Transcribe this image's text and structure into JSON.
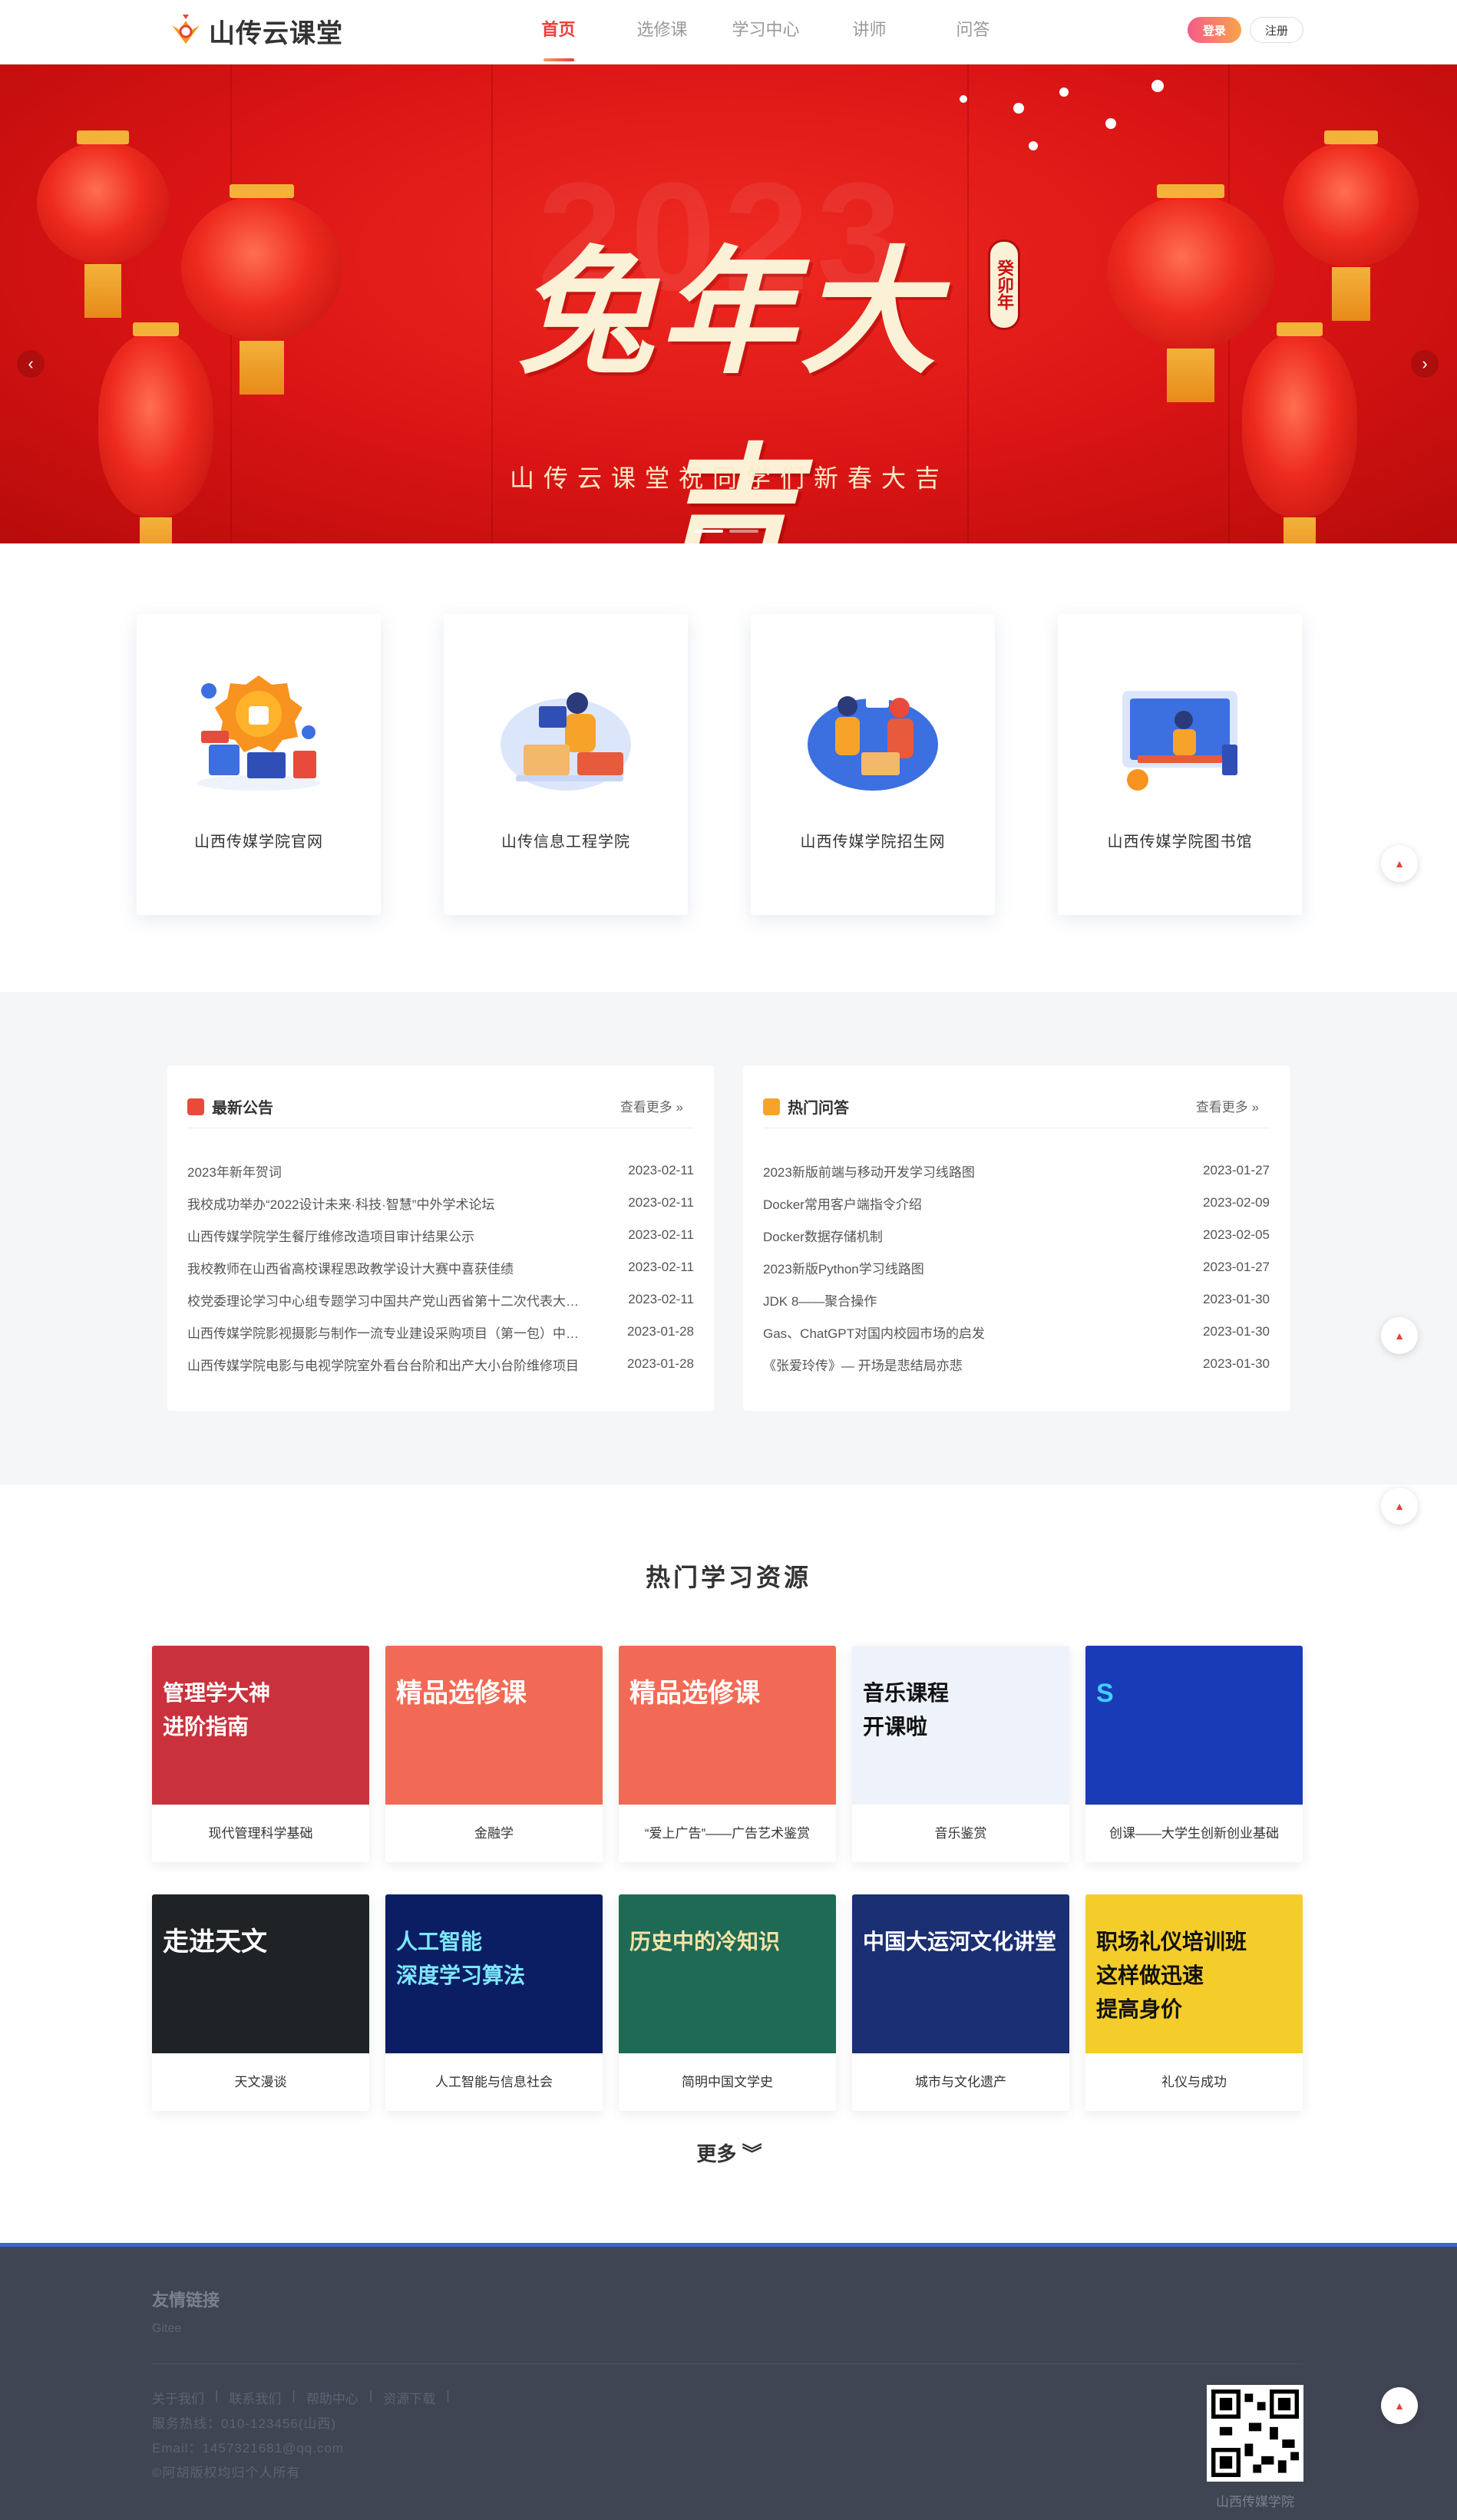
{
  "header": {
    "logo_text": "山传云课堂",
    "nav": [
      "首页",
      "选修课",
      "学习中心",
      "讲师",
      "问答"
    ],
    "login": "登录",
    "register": "注册"
  },
  "banner": {
    "title": "兔年大吉",
    "year": "2023",
    "seal": "癸卯年",
    "subtitle": "山传云课堂祝同学们新春大吉",
    "prev": "‹",
    "next": "›"
  },
  "quick_links": [
    {
      "label": "山西传媒学院官网",
      "icon": "promo-badge-icon"
    },
    {
      "label": "山传信息工程学院",
      "icon": "student-laptop-icon"
    },
    {
      "label": "山西传媒学院招生网",
      "icon": "team-meeting-icon"
    },
    {
      "label": "山西传媒学院图书馆",
      "icon": "library-desk-icon"
    }
  ],
  "news": {
    "title": "最新公告",
    "more": "查看更多 »",
    "items": [
      {
        "text": "2023年新年贺词",
        "date": "2023-02-11"
      },
      {
        "text": "我校成功举办“2022设计未来·科技·智慧”中外学术论坛",
        "date": "2023-02-11"
      },
      {
        "text": "山西传媒学院学生餐厅维修改造项目审计结果公示",
        "date": "2023-02-11"
      },
      {
        "text": "我校教师在山西省高校课程思政教学设计大赛中喜获佳绩",
        "date": "2023-02-11"
      },
      {
        "text": "校党委理论学习中心组专题学习中国共产党山西省第十二次代表大会精神",
        "date": "2023-02-11"
      },
      {
        "text": "山西传媒学院影视摄影与制作一流专业建设采购项目（第一包）中标公告",
        "date": "2023-01-28"
      },
      {
        "text": "山西传媒学院电影与电视学院室外看台台阶和出产大小台阶维修项目",
        "date": "2023-01-28"
      }
    ]
  },
  "qa": {
    "title": "热门问答",
    "more": "查看更多 »",
    "items": [
      {
        "text": "2023新版前端与移动开发学习线路图",
        "date": "2023-01-27"
      },
      {
        "text": "Docker常用客户端指令介绍",
        "date": "2023-02-09"
      },
      {
        "text": "Docker数据存储机制",
        "date": "2023-02-05"
      },
      {
        "text": "2023新版Python学习线路图",
        "date": "2023-01-27"
      },
      {
        "text": "JDK 8——聚合操作",
        "date": "2023-01-30"
      },
      {
        "text": "Gas、ChatGPT对国内校园市场的启发",
        "date": "2023-01-30"
      },
      {
        "text": "《张爱玲传》— 开场是悲结局亦悲",
        "date": "2023-01-30"
      }
    ]
  },
  "resources": {
    "title": "热门学习资源",
    "more": "更多 ︾",
    "items": [
      {
        "label": "现代管理科学基础",
        "cover": "管理学大神\n进阶指南",
        "bg": "#c9323c",
        "fg": "#ffffff"
      },
      {
        "label": "金融学",
        "cover": "精品选修课",
        "bg": "#f26a55",
        "fg": "#ffffff"
      },
      {
        "label": "“爱上广告”——广告艺术鉴赏",
        "cover": "精品选修课",
        "bg": "#f26a55",
        "fg": "#ffffff"
      },
      {
        "label": "音乐鉴赏",
        "cover": "音乐课程\n开课啦",
        "bg": "#eef3fb",
        "fg": "#111111"
      },
      {
        "label": "创课——大学生创新创业基础",
        "cover": "S",
        "bg": "#1a3bb8",
        "fg": "#3fd0ff"
      },
      {
        "label": "天文漫谈",
        "cover": "走进天文",
        "bg": "#1f2326",
        "fg": "#ffffff"
      },
      {
        "label": "人工智能与信息社会",
        "cover": "人工智能\n深度学习算法",
        "bg": "#0b1e63",
        "fg": "#7de7ff"
      },
      {
        "label": "简明中国文学史",
        "cover": "历史中的冷知识",
        "bg": "#1e6a55",
        "fg": "#f7e3a6"
      },
      {
        "label": "城市与文化遗产",
        "cover": "中国大运河文化讲堂",
        "bg": "#1b2f73",
        "fg": "#ffffff"
      },
      {
        "label": "礼仪与成功",
        "cover": "职场礼仪培训班\n这样做迅速\n提高身价",
        "bg": "#f4cd2a",
        "fg": "#111111"
      }
    ]
  },
  "footer": {
    "title": "友情链接",
    "gitee": "Gitee",
    "links": [
      "关于我们",
      "|",
      "联系我们",
      "|",
      "帮助中心",
      "|",
      "资源下载",
      "|"
    ],
    "hotline": "服务热线：010-123456(山西)",
    "email": "Email：1457321681@qq.com",
    "copyright": "©阿胡版权均归个人所有",
    "qr_label": "山西传媒学院"
  },
  "colors": {
    "accent": "#e8403c",
    "footer_bg": "#404553",
    "footer_top": "#3f63d6"
  }
}
